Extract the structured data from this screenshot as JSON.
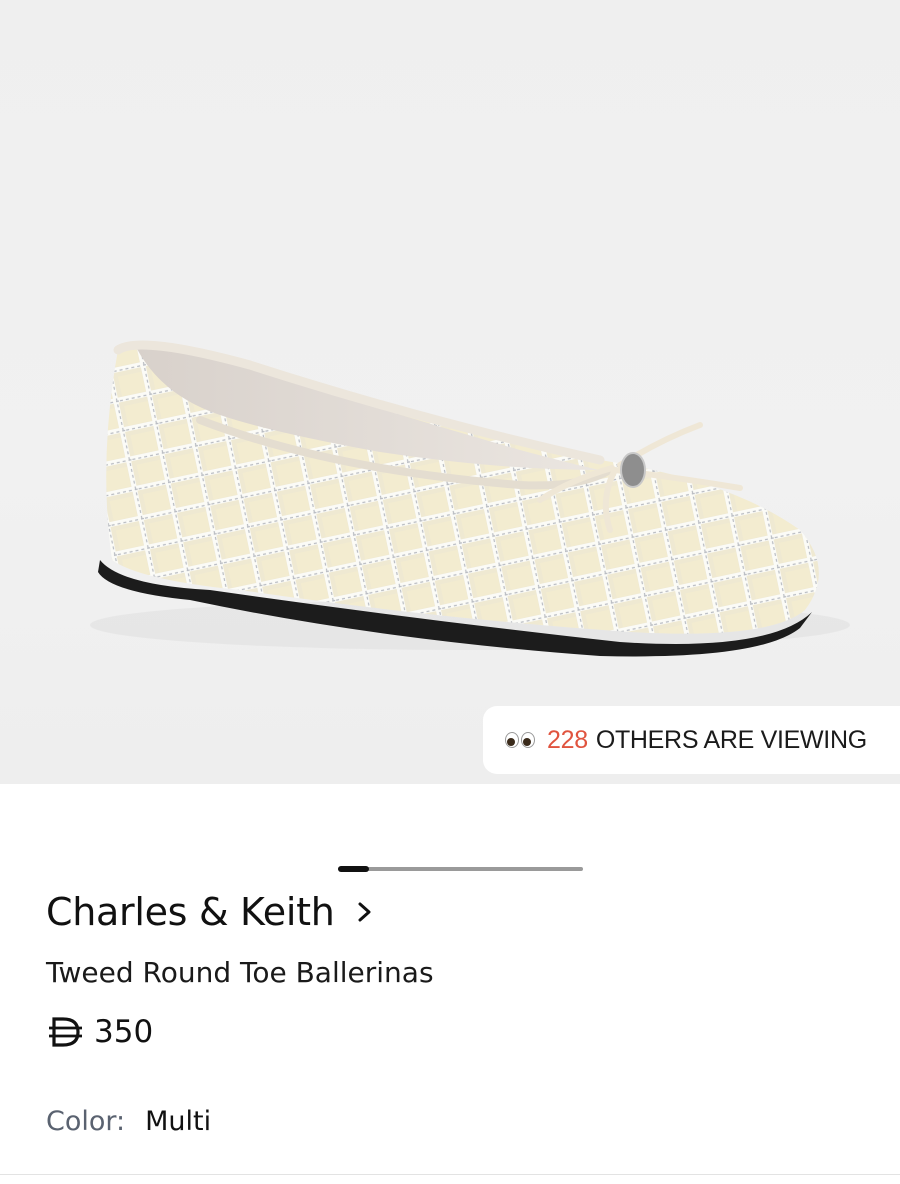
{
  "product_image": {
    "icon": "ballerina-shoe-image"
  },
  "viewing_badge": {
    "count": "228",
    "text": "OTHERS ARE VIEWING",
    "count_color": "#e0543f",
    "icon": "eyes-icon"
  },
  "gallery": {
    "current_slide": 1,
    "total_slides": 8
  },
  "brand": {
    "name": "Charles & Keith",
    "icon": "chevron-right-icon"
  },
  "product": {
    "name": "Tweed Round Toe Ballerinas"
  },
  "price": {
    "currency_icon": "dirham-icon",
    "amount": "350"
  },
  "color": {
    "label": "Color:",
    "value": "Multi"
  }
}
